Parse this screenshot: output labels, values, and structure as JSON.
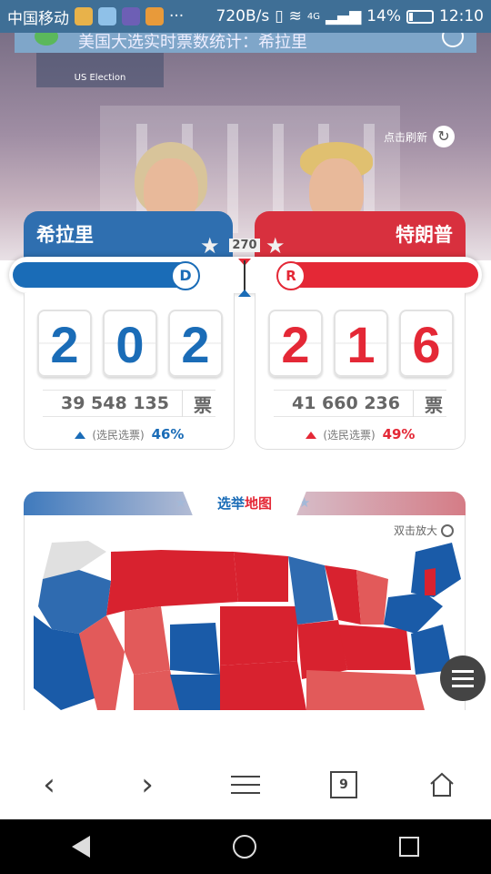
{
  "status": {
    "carrier": "中国移动",
    "more": "···",
    "speed": "720B/s",
    "network": "4G",
    "battery": "14%",
    "time": "12:10"
  },
  "hero": {
    "notice": "美国大选实时票数统计：希拉里",
    "sub_logo": "US Election",
    "refresh_label": "点击刷新"
  },
  "candidates": {
    "left": {
      "name": "希拉里",
      "party_symbol": "D",
      "electoral_digits": [
        "2",
        "0",
        "2"
      ],
      "popular_votes": "39 548 135",
      "votes_unit": "票",
      "pct_label": "(选民选票)",
      "pct": "46%",
      "color": "#1a6cb7"
    },
    "right": {
      "name": "特朗普",
      "party_symbol": "R",
      "electoral_digits": [
        "2",
        "1",
        "6"
      ],
      "popular_votes": "41 660 236",
      "votes_unit": "票",
      "pct_label": "(选民选票)",
      "pct": "49%",
      "color": "#e42836"
    }
  },
  "progress": {
    "threshold_label": "270",
    "left_electoral": 202,
    "right_electoral": 216,
    "total": 538
  },
  "map": {
    "title_part1": "选举",
    "title_part2": "地图",
    "zoom_hint": "双击放大"
  },
  "browser_nav": {
    "tab_count": "9"
  }
}
